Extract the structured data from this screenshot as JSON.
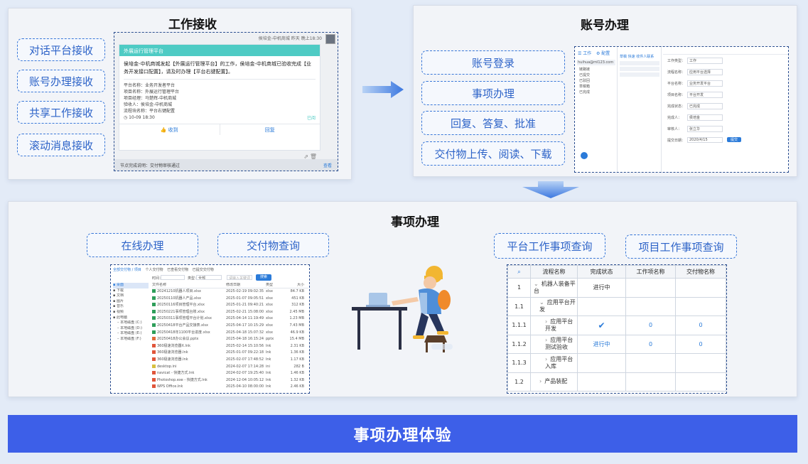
{
  "panel_receive": {
    "title": "工作接收",
    "options": [
      "对话平台接收",
      "账号办理接收",
      "共享工作接收",
      "滚动消息接收"
    ],
    "chat": {
      "sender_meta": "侯培金-中机商城  昨天 晚上18:30",
      "card_header": "外展运行管理平台",
      "message": "侯培金-中机商城发起【外展运行管理平台】的工作，侯培金-中机商城已验收完成【业务开发接口配置】，请及时办理【平台右键配置】。",
      "fields": [
        "平台名称：业务开发者平台",
        "项目名称：外展运行管理平台",
        "项目经理：马楚辉-中机商城",
        "验收人：侯培金-中机商城",
        "流程块名称：平台右键配置"
      ],
      "time": "10-09 18:30",
      "tag": "已阅",
      "action_receive": "收到",
      "action_reply": "回复",
      "footer_note": "节点完成说明：交付物审核通过",
      "footer_link": "查看"
    }
  },
  "panel_account": {
    "title": "账号办理",
    "options": [
      "账号登录",
      "事项办理",
      "回复、答复、批准",
      "交付物上传、阅读、下载"
    ],
    "shot": {
      "nav_work": "工作",
      "nav_config": "配置",
      "account": "huihua@ml123.com",
      "menu": [
        "链路链",
        "已提交",
        "已驳回",
        "草稿箱",
        "已完成"
      ],
      "tabs": [
        "草稿",
        "快速",
        "收件人联系"
      ],
      "form_labels": [
        "工作类型：",
        "流程名称：",
        "平台名称：",
        "项目名称：",
        "完成状态：",
        "完成人：",
        "审核人：",
        "提交日期："
      ],
      "form_values": [
        "工作",
        "应用平台选择",
        "业务开发平台",
        "平台开发",
        "已完成",
        "侯培金",
        "张立华",
        "2020/4/15"
      ],
      "submit": "提交"
    }
  },
  "panel_matters": {
    "title": "事项办理",
    "left_options": [
      "在线办理",
      "交付物查询"
    ],
    "right_options": [
      "平台工作事项查询",
      "项目工作事项查询"
    ],
    "explorer": {
      "crumbs": [
        "全部交付物 / 项目",
        "个人交付物",
        "已查看交付物",
        "已提交交付物"
      ],
      "filter_label": "时间：",
      "type_label": "类型：",
      "type_value": "全部",
      "search_placeholder": "请输入关键词",
      "search_btn": "搜索",
      "sidebar": [
        "桌面",
        "下载",
        "文档",
        "图片",
        "音乐",
        "视频",
        "此电脑",
        "本地磁盘 (C:)",
        "本地磁盘 (D:)",
        "本地磁盘 (E:)",
        "本地磁盘 (F:)"
      ],
      "columns": [
        "文件名称",
        "修改日期",
        "类型",
        "大小"
      ],
      "rows": [
        [
          "20241210机器人项目.xlsx",
          "2025-02-19 09:02:35",
          "xlsx",
          "84.7 KB"
        ],
        [
          "20250110机器人产品.xlsx",
          "2025-01-07 09:05:51",
          "xlsx",
          "451 KB"
        ],
        [
          "20250116项目管理平台.xlsx",
          "2025-01-21 09:40:21",
          "xlsx",
          "312 KB"
        ],
        [
          "20250221事项管理台账.xlsx",
          "2025-02-21 15:08:00",
          "xlsx",
          "2.45 MB"
        ],
        [
          "20250311事项管理平台计划.xlsx",
          "2025-04-14 11:19:49",
          "xlsx",
          "1.23 MB"
        ],
        [
          "20250418平台产品交接表.xlsx",
          "2025-04-17 10:15:29",
          "xlsx",
          "7.43 MB"
        ],
        [
          "20250418年1100平台进度.xlsx",
          "2025-04-18 15:07:32",
          "xlsx",
          "46.9 KB"
        ],
        [
          "20250418办公会议.pptx",
          "2025-04-18 16:15:24",
          "pptx",
          "15.4 MB"
        ],
        [
          "360极速浏览器X.lnk",
          "2025-02-14 15:10:56",
          "lnk",
          "2.31 KB"
        ],
        [
          "360极速浏览器.lnk",
          "2025-01-07 09:22:18",
          "lnk",
          "1.36 KB"
        ],
        [
          "360极速浏览器.lnk",
          "2025-02-07 17:48:52",
          "lnk",
          "1.17 KB"
        ],
        [
          "desktop.ini",
          "2024-02-07 17:14:28",
          "ini",
          "282 B"
        ],
        [
          "navicat - 快捷方式.lnk",
          "2024-02-07 19:25:40",
          "lnk",
          "1.46 KB"
        ],
        [
          "Photoshop.exe - 快捷方式.lnk",
          "2024-12-04 10:05:12",
          "lnk",
          "1.32 KB"
        ],
        [
          "WPS Office.lnk",
          "2025-04-10 08:00:00",
          "lnk",
          "2.46 KB"
        ]
      ]
    },
    "query_table": {
      "headers": [
        "流程名称",
        "完成状态",
        "工作项名称",
        "交付物名称"
      ],
      "rows": [
        {
          "no": "1",
          "name": "机器人装备平台",
          "status": "进行中",
          "work": "",
          "deliv": "",
          "arrow": "v",
          "indent": 0
        },
        {
          "no": "1.1",
          "name": "应用平台开发",
          "status": "",
          "work": "",
          "deliv": "",
          "arrow": "v",
          "indent": 1
        },
        {
          "no": "1.1.1",
          "name": "应用平台开发",
          "status": "✔",
          "work": "0",
          "deliv": "0",
          "arrow": ">",
          "indent": 2
        },
        {
          "no": "1.1.2",
          "name": "应用平台测试验收",
          "status": "进行中",
          "work": "0",
          "deliv": "0",
          "arrow": ">",
          "indent": 2
        },
        {
          "no": "1.1.3",
          "name": "应用平台入库",
          "status": "",
          "work": "",
          "deliv": "",
          "arrow": ">",
          "indent": 2
        },
        {
          "no": "1.2",
          "name": "产品装配",
          "status": "",
          "work": "",
          "deliv": "",
          "arrow": ">",
          "indent": 1
        }
      ]
    }
  },
  "bottom_banner": "事项办理体验",
  "colors": {
    "accent": "#3d5fe8",
    "dash": "#3a78d8",
    "teal": "#4ecbc4"
  }
}
